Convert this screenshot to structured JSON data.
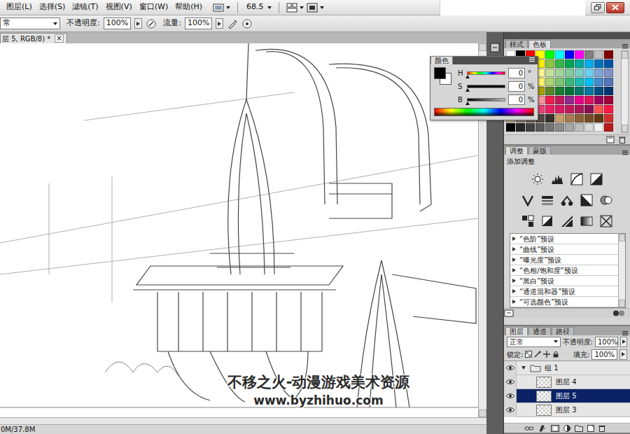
{
  "menu_bar": {
    "items": [
      "图层(L)",
      "选择(S)",
      "滤镜(T)",
      "视图(V)",
      "窗口(W)",
      "帮助(H)"
    ],
    "zoom": "68.5"
  },
  "options_bar": {
    "mode": "常",
    "opacity_label": "不透明度:",
    "opacity": "100%",
    "flow_label": "流量:",
    "flow": "100%"
  },
  "document_tab": {
    "title": "层 5, RGB/8) *",
    "close": "×"
  },
  "color_panel": {
    "title": "颜色",
    "foreground": "#000000",
    "background": "#ffffff",
    "channels": [
      {
        "label": "H",
        "value": "0",
        "unit": "°",
        "level": 0
      },
      {
        "label": "S",
        "value": "0",
        "unit": "%",
        "level": 0
      },
      {
        "label": "B",
        "value": "0",
        "unit": "%",
        "level": 0
      }
    ]
  },
  "swatches_panel": {
    "tabs": [
      {
        "label": "样式",
        "selected": false
      },
      {
        "label": "色板",
        "selected": true
      }
    ],
    "swatches": [
      [
        "#ffffff",
        "#000000",
        "#ff0000",
        "#ffff00",
        "#00ff00",
        "#00ffff",
        "#0000ff",
        "#ff00ff",
        "#808080",
        "#c0c0c0",
        "#800000"
      ],
      [
        "#ed1c24",
        "#f26522",
        "#f7941d",
        "#fff200",
        "#8dc63f",
        "#39b54a",
        "#00a651",
        "#00a99d",
        "#00aeef",
        "#0072bc",
        "#0054a6"
      ],
      [
        "#f7977a",
        "#f9ad81",
        "#fdc68a",
        "#fff79a",
        "#c4df9b",
        "#a3d39c",
        "#82ca9d",
        "#7bcdc8",
        "#6ecff6",
        "#7ea7d8",
        "#8393ca"
      ],
      [
        "#f26c4f",
        "#f68e55",
        "#fbaf5c",
        "#fff467",
        "#acd372",
        "#7cc576",
        "#3bb878",
        "#1abbb4",
        "#00bff3",
        "#448ccb",
        "#5574b9"
      ],
      [
        "#9e0b0f",
        "#a0410d",
        "#a36209",
        "#aba000",
        "#598527",
        "#197b30",
        "#007236",
        "#00746b",
        "#0076a3",
        "#004b80",
        "#003471"
      ],
      [
        "#ed145b",
        "#f06eaa",
        "#f49ac1",
        "#f5989d",
        "#ee1d4c",
        "#c2185b",
        "#92278f",
        "#ec008c",
        "#e0115f",
        "#9e005d",
        "#9e0039"
      ],
      [
        "#f9c0c0",
        "#f48fb1",
        "#f06292",
        "#ec407a",
        "#e91e63",
        "#d81b60",
        "#c2185b",
        "#ad1457",
        "#880e4f",
        "#ff5252",
        "#ff1744"
      ],
      [
        "#c7b299",
        "#998675",
        "#736357",
        "#534741",
        "#37302a",
        "#c69c6d",
        "#a67c52",
        "#8c6239",
        "#754c24",
        "#603913",
        "#d32f2f"
      ],
      [
        "#000000",
        "#262626",
        "#404040",
        "#595959",
        "#737373",
        "#8c8c8c",
        "#a6a6a6",
        "#bfbfbf",
        "#d9d9d9",
        "#f2f2f2",
        "#b71c1c"
      ]
    ]
  },
  "adjustments_panel": {
    "tabs": [
      {
        "label": "调整",
        "selected": true
      },
      {
        "label": "蒙版",
        "selected": false
      }
    ],
    "heading": "添加调整",
    "presets": [
      {
        "label": "“色阶”预设",
        "expanded": false
      },
      {
        "label": "“曲线”预设",
        "expanded": false
      },
      {
        "label": "“曝光度”预设",
        "expanded": false
      },
      {
        "label": "“色相/饱和度”预设",
        "expanded": false
      },
      {
        "label": "“黑白”预设",
        "expanded": false
      },
      {
        "label": "“通道混和器”预设",
        "expanded": false
      },
      {
        "label": "“可选颜色”预设",
        "expanded": false
      }
    ]
  },
  "layers_panel": {
    "tabs": [
      {
        "label": "图层",
        "selected": true
      },
      {
        "label": "通道",
        "selected": false
      },
      {
        "label": "路径",
        "selected": false
      }
    ],
    "blend_mode": "正常",
    "opacity_label": "不透明度:",
    "opacity": "100%",
    "lock_label": "锁定:",
    "fill_label": "填充:",
    "fill": "100%",
    "layers": [
      {
        "name": "组 1",
        "kind": "group",
        "visible": true,
        "expanded": true,
        "selected": false
      },
      {
        "name": "图层 4",
        "kind": "layer",
        "visible": true,
        "selected": false
      },
      {
        "name": "图层 5",
        "kind": "layer",
        "visible": true,
        "selected": true
      },
      {
        "name": "图层 3",
        "kind": "layer",
        "visible": true,
        "selected": false
      }
    ]
  },
  "status_bar": {
    "text": "0M/37.8M"
  },
  "watermark": {
    "lines": [
      "不移之火-动漫游戏美术资源",
      "www.byzhihuo.com"
    ]
  }
}
